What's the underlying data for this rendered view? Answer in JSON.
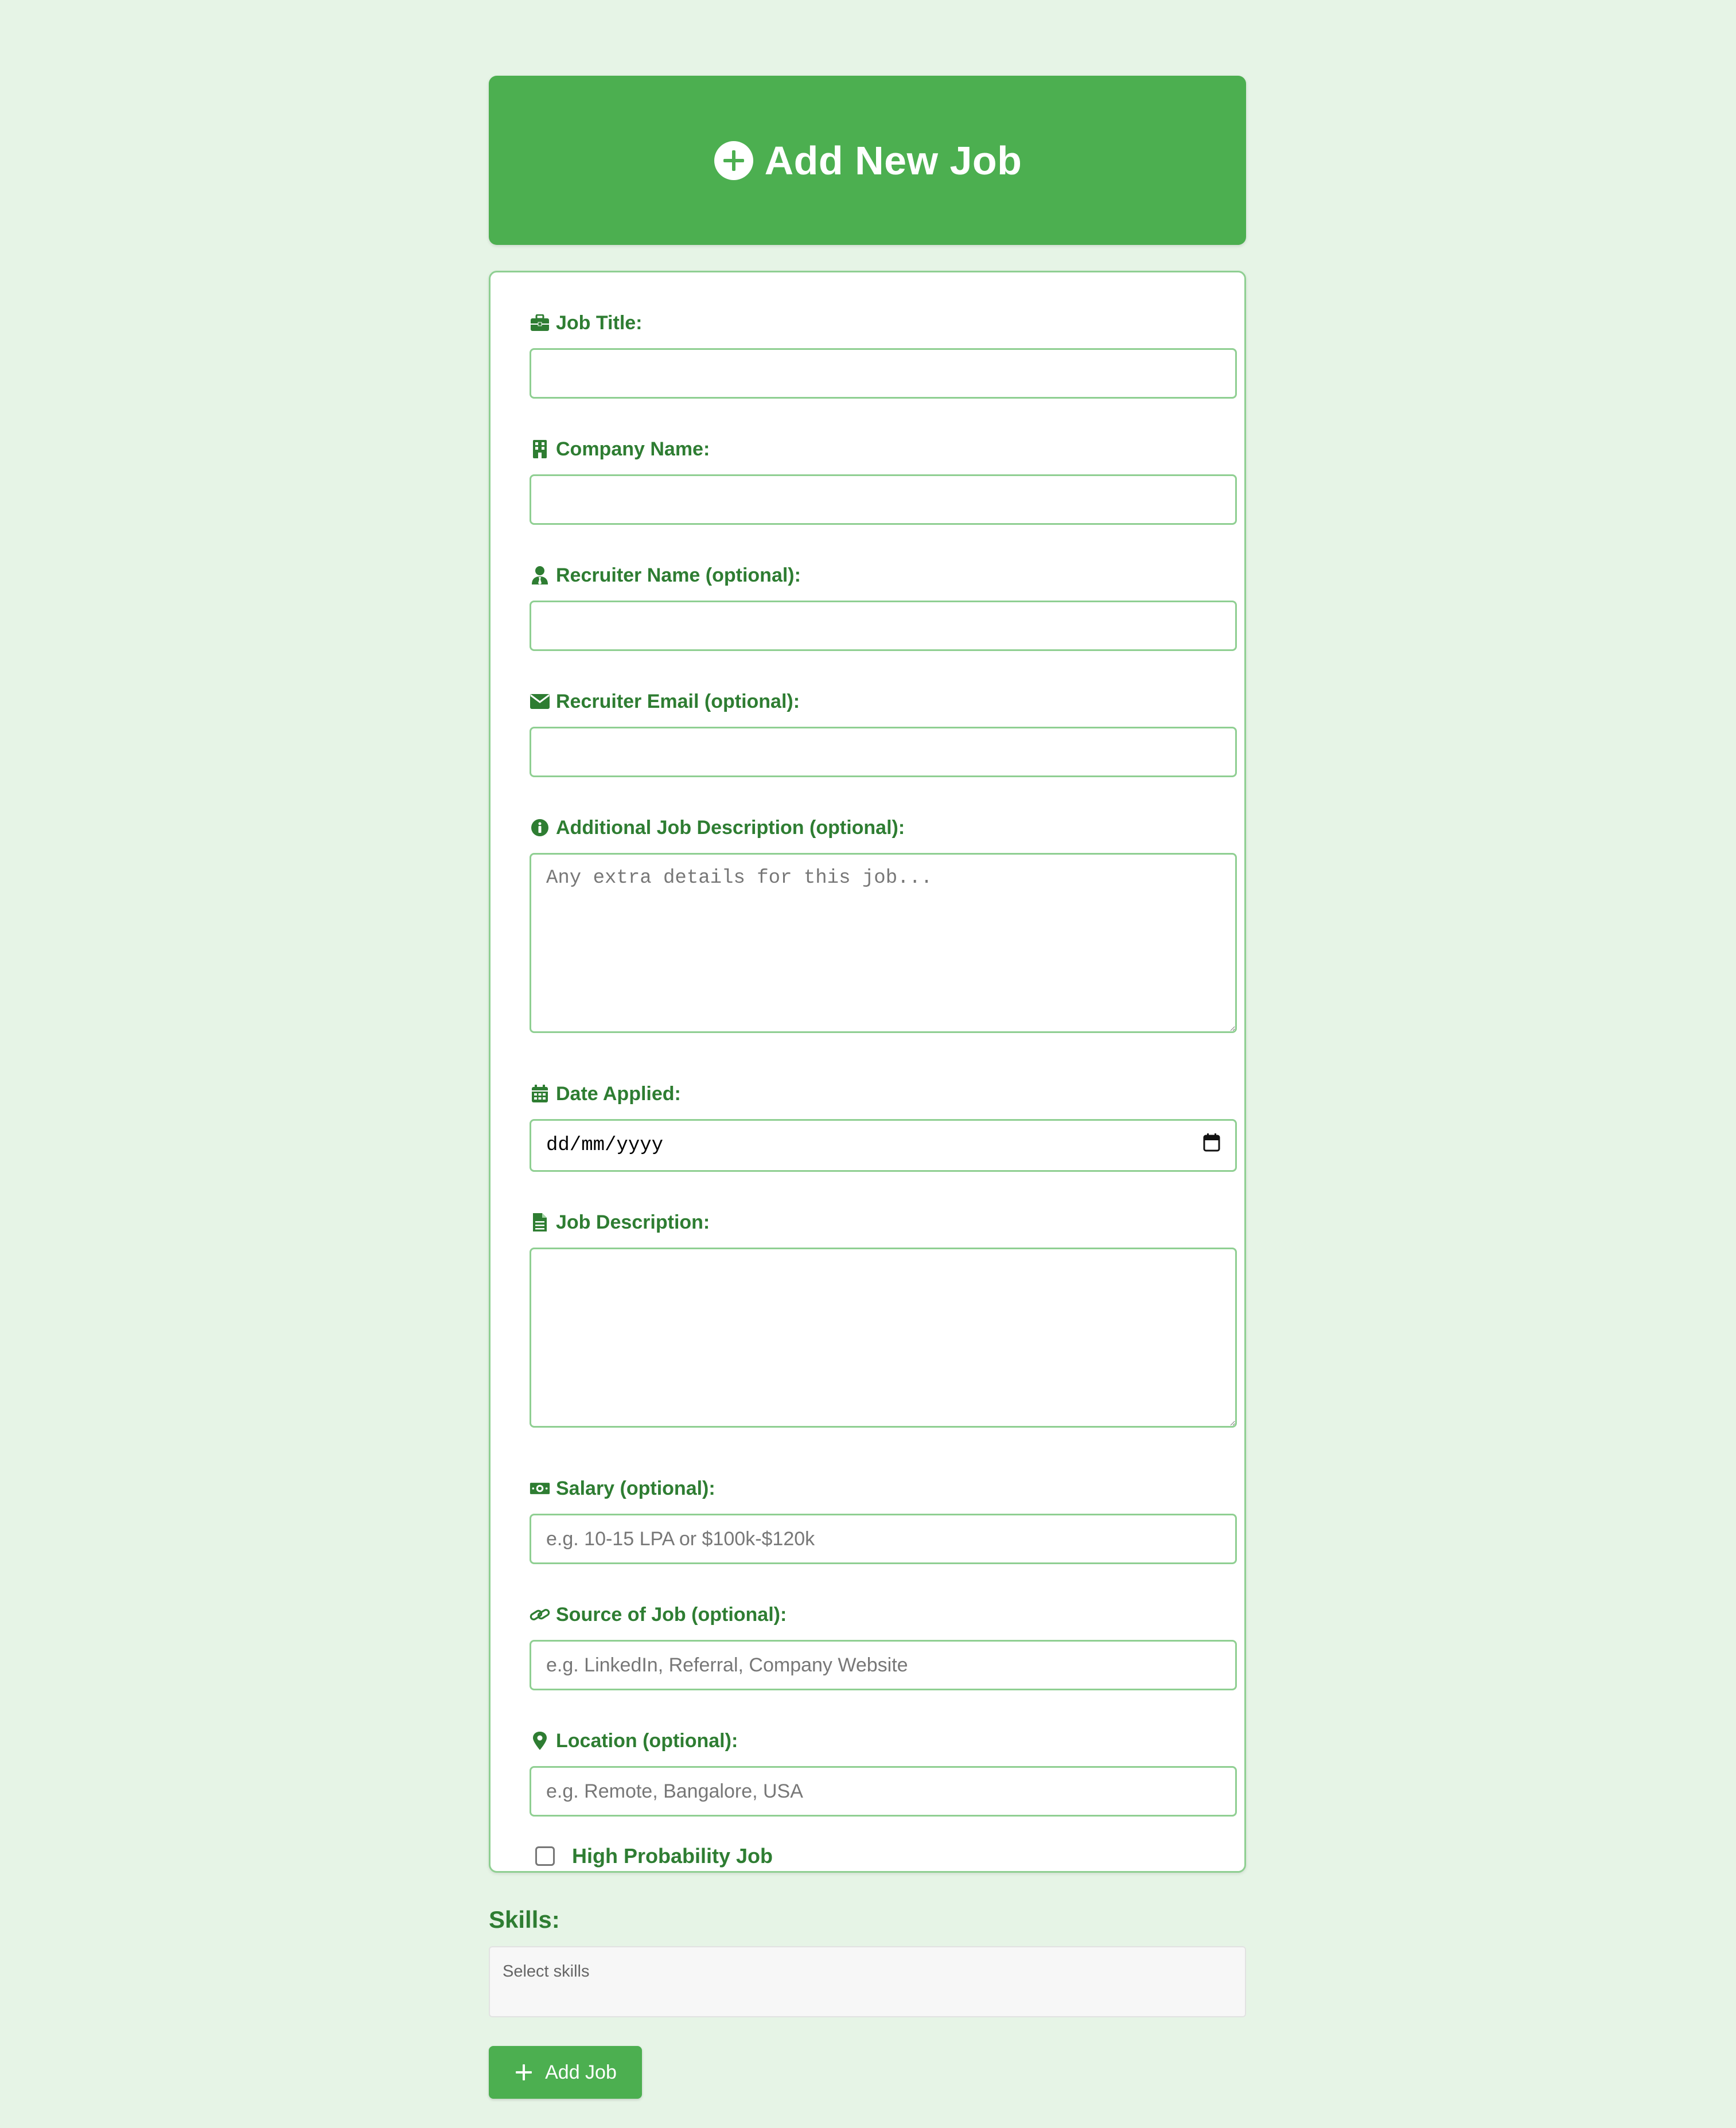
{
  "header": {
    "title": "Add New Job",
    "icon": "plus-circle-icon"
  },
  "form": {
    "job_title": {
      "label": "Job Title:",
      "icon": "briefcase-icon",
      "value": ""
    },
    "company_name": {
      "label": "Company Name:",
      "icon": "building-icon",
      "value": ""
    },
    "recruiter_name": {
      "label": "Recruiter Name (optional):",
      "icon": "user-tie-icon",
      "value": ""
    },
    "recruiter_email": {
      "label": "Recruiter Email (optional):",
      "icon": "envelope-icon",
      "value": ""
    },
    "additional_description": {
      "label": "Additional Job Description (optional):",
      "icon": "info-circle-icon",
      "placeholder": "Any extra details for this job...",
      "value": ""
    },
    "date_applied": {
      "label": "Date Applied:",
      "icon": "calendar-icon",
      "placeholder": "dd/mm/yyyy"
    },
    "job_description": {
      "label": "Job Description:",
      "icon": "file-icon",
      "value": ""
    },
    "salary": {
      "label": "Salary (optional):",
      "icon": "money-bill-icon",
      "placeholder": "e.g. 10-15 LPA or $100k-$120k"
    },
    "source": {
      "label": "Source of Job (optional):",
      "icon": "link-icon",
      "placeholder": "e.g. LinkedIn, Referral, Company Website"
    },
    "location": {
      "label": "Location (optional):",
      "icon": "map-marker-icon",
      "placeholder": "e.g. Remote, Bangalore, USA"
    },
    "high_probability": {
      "label": "High Probability Job",
      "checked": false
    }
  },
  "skills": {
    "title": "Skills:",
    "placeholder": "Select skills"
  },
  "submit": {
    "label": "Add Job",
    "icon": "plus-icon"
  },
  "colors": {
    "accent": "#4caf50",
    "label_text": "#2e7d32",
    "background": "#e6f4e6",
    "input_border": "#8fcf92"
  }
}
